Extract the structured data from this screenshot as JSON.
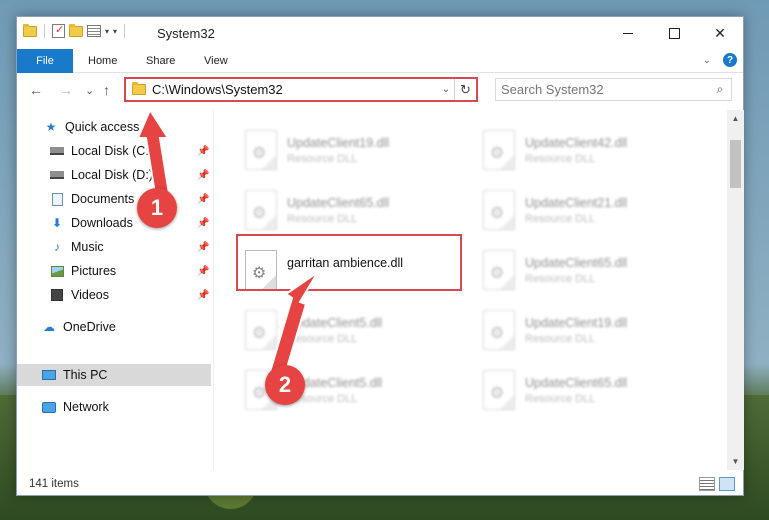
{
  "window": {
    "title": "System32",
    "minimize_label": "",
    "maximize_label": "",
    "close_label": "✕"
  },
  "quick_access_toolbar": {
    "dropdown_glyph": "▾",
    "customize_glyph": "▾"
  },
  "ribbon": {
    "tabs": [
      "File",
      "Home",
      "Share",
      "View"
    ],
    "collapse_glyph": "⌄",
    "help_glyph": "?"
  },
  "address_bar": {
    "back_glyph": "←",
    "forward_glyph": "→",
    "recent_glyph": "⌄",
    "up_glyph": "↑",
    "path": "C:\\Windows\\System32",
    "dropdown_glyph": "⌄",
    "refresh_glyph": "↻"
  },
  "search": {
    "placeholder": "Search System32",
    "icon_glyph": "⌕"
  },
  "sidebar": {
    "quick_access": "Quick access",
    "items": [
      {
        "label": "Local Disk (C:)",
        "pinned": true
      },
      {
        "label": "Local Disk (D:)",
        "pinned": true
      },
      {
        "label": "Documents",
        "pinned": true
      },
      {
        "label": "Downloads",
        "pinned": true
      },
      {
        "label": "Music",
        "pinned": true
      },
      {
        "label": "Pictures",
        "pinned": true
      },
      {
        "label": "Videos",
        "pinned": true
      }
    ],
    "pin_glyph": "📌",
    "onedrive": "OneDrive",
    "this_pc": "This PC",
    "network": "Network"
  },
  "files": {
    "left_column": [
      {
        "name": "UpdateClient19.dll",
        "type": "Resource DLL"
      },
      {
        "name": "UpdateClient65.dll",
        "type": "Resource DLL"
      },
      {
        "name": "garritan ambience.dll",
        "type": ""
      },
      {
        "name": "UpdateClient5.dll",
        "type": "Resource DLL"
      },
      {
        "name": "UpdateClient5.dll",
        "type": "Resource DLL"
      }
    ],
    "right_column": [
      {
        "name": "UpdateClient42.dll",
        "type": "Resource DLL"
      },
      {
        "name": "UpdateClient21.dll",
        "type": "Resource DLL"
      },
      {
        "name": "UpdateClient65.dll",
        "type": "Resource DLL"
      },
      {
        "name": "UpdateClient19.dll",
        "type": "Resource DLL"
      },
      {
        "name": "UpdateClient65.dll",
        "type": "Resource DLL"
      }
    ]
  },
  "scrollbar": {
    "up_glyph": "▲",
    "down_glyph": "▼"
  },
  "status_bar": {
    "item_count": "141 items"
  },
  "annotations": {
    "step1": "1",
    "step2": "2",
    "color": "#e64343"
  }
}
